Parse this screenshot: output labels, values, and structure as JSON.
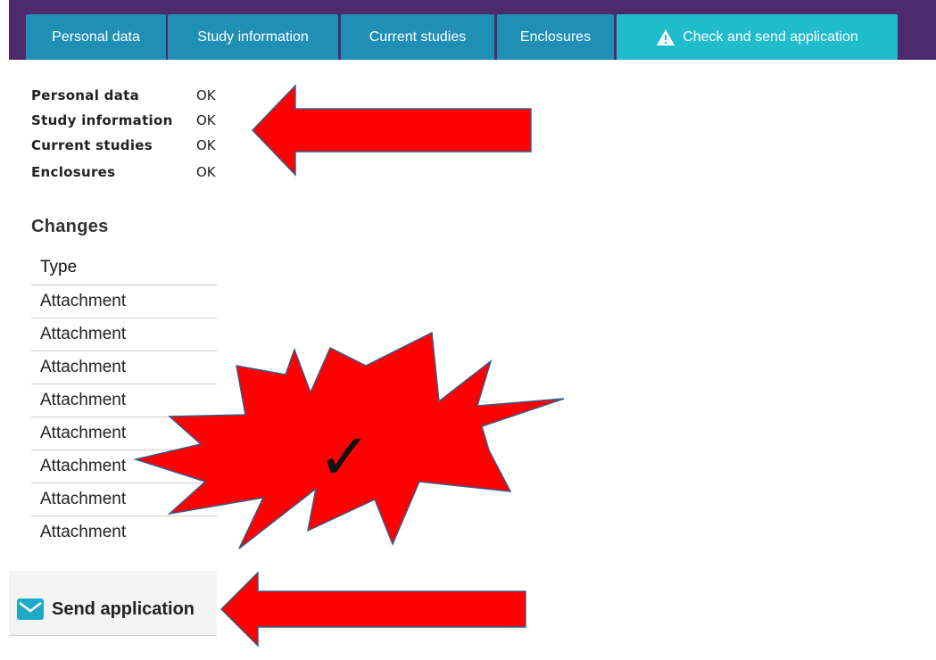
{
  "tabs": [
    {
      "label": "Personal data"
    },
    {
      "label": "Study information"
    },
    {
      "label": "Current studies"
    },
    {
      "label": "Enclosures"
    },
    {
      "label": "Check and send application"
    }
  ],
  "summary": [
    {
      "label": "Personal data",
      "status": "OK"
    },
    {
      "label": "Study information",
      "status": "OK"
    },
    {
      "label": "Current studies",
      "status": "OK"
    },
    {
      "label": "Enclosures",
      "status": "OK"
    }
  ],
  "changes": {
    "title": "Changes",
    "column_header": "Type",
    "rows": [
      "Attachment",
      "Attachment",
      "Attachment",
      "Attachment",
      "Attachment",
      "Attachment",
      "Attachment",
      "Attachment"
    ]
  },
  "send": {
    "label": "Send application"
  },
  "annotation": {
    "check_mark": "✓"
  },
  "colors": {
    "tabbar": "#4d2a6b",
    "tab": "#1f8fb5",
    "tab_active": "#1fbccc",
    "arrow": "#ff0000",
    "arrow_outline": "#3a5a8a"
  },
  "icons": {
    "warning": "warning-triangle-icon",
    "send": "envelope-icon"
  }
}
